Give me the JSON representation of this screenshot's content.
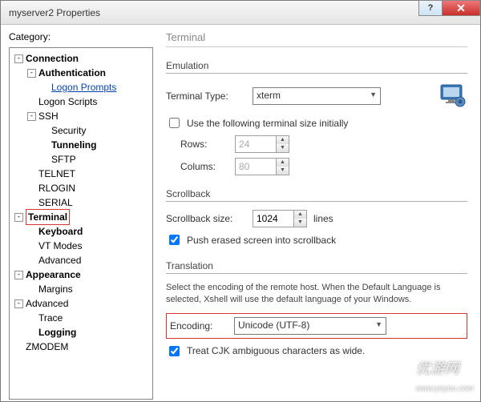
{
  "window": {
    "title": "myserver2 Properties"
  },
  "left": {
    "category_label": "Category:",
    "tree": {
      "connection": "Connection",
      "authentication": "Authentication",
      "logon_prompts": "Logon Prompts",
      "logon_scripts": "Logon Scripts",
      "ssh": "SSH",
      "security": "Security",
      "tunneling": "Tunneling",
      "sftp": "SFTP",
      "telnet": "TELNET",
      "rlogin": "RLOGIN",
      "serial": "SERIAL",
      "terminal": "Terminal",
      "keyboard": "Keyboard",
      "vt_modes": "VT Modes",
      "advanced": "Advanced",
      "appearance": "Appearance",
      "margins": "Margins",
      "advanced2": "Advanced",
      "trace": "Trace",
      "logging": "Logging",
      "zmodem": "ZMODEM"
    }
  },
  "right": {
    "title": "Terminal",
    "emulation": {
      "group": "Emulation",
      "terminal_type_label": "Terminal Type:",
      "terminal_type_value": "xterm",
      "use_size_label": "Use the following terminal size initially",
      "use_size_checked": false,
      "rows_label": "Rows:",
      "rows_value": "24",
      "cols_label": "Colums:",
      "cols_value": "80"
    },
    "scrollback": {
      "group": "Scrollback",
      "size_label": "Scrollback size:",
      "size_value": "1024",
      "size_unit": "lines",
      "push_label": "Push erased screen into scrollback",
      "push_checked": true
    },
    "translation": {
      "group": "Translation",
      "desc": "Select the encoding of the remote host. When the Default Language is selected, Xshell will use the default language of your Windows.",
      "encoding_label": "Encoding:",
      "encoding_value": "Unicode (UTF-8)",
      "cjk_label": "Treat CJK ambiguous characters as wide.",
      "cjk_checked": true
    }
  },
  "watermark": "优游网",
  "watermark_url": "www.yoyou.com"
}
